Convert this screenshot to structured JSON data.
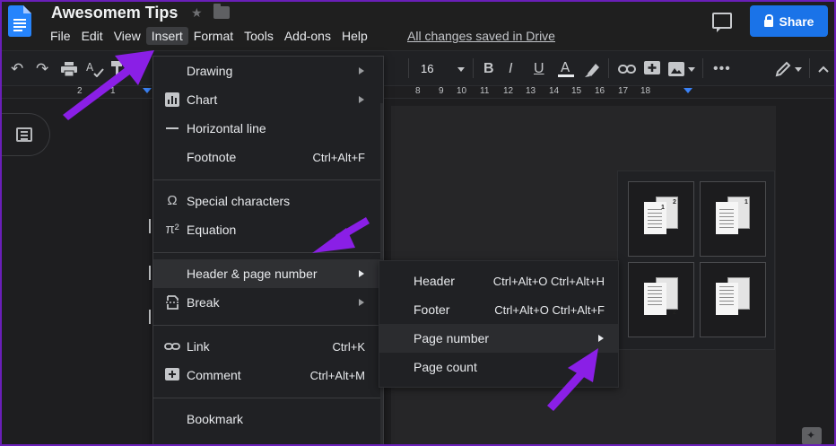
{
  "window": {
    "doc_title": "Awesomem Tips",
    "saved_status": "All changes saved in Drive",
    "share_label": "Share"
  },
  "menubar": [
    "File",
    "Edit",
    "View",
    "Insert",
    "Format",
    "Tools",
    "Add-ons",
    "Help"
  ],
  "toolbar": {
    "font_size": "16"
  },
  "ruler": {
    "labels": [
      "2",
      "1",
      "8",
      "9",
      "10",
      "11",
      "12",
      "13",
      "14",
      "15",
      "16",
      "17",
      "18"
    ]
  },
  "insert_menu": {
    "drawing": "Drawing",
    "chart": "Chart",
    "horizontal_line": "Horizontal line",
    "footnote": "Footnote",
    "footnote_shortcut": "Ctrl+Alt+F",
    "special_characters": "Special characters",
    "equation": "Equation",
    "header_page_number": "Header & page number",
    "break": "Break",
    "link": "Link",
    "link_shortcut": "Ctrl+K",
    "comment": "Comment",
    "comment_shortcut": "Ctrl+Alt+M",
    "bookmark": "Bookmark"
  },
  "submenu": {
    "header": "Header",
    "header_shortcut": "Ctrl+Alt+O Ctrl+Alt+H",
    "footer": "Footer",
    "footer_shortcut": "Ctrl+Alt+O Ctrl+Alt+F",
    "page_number": "Page number",
    "page_count": "Page count"
  },
  "page_number_options": {
    "top_right": "2",
    "top_right_skip_first": "1",
    "bottom_right": "2",
    "bottom_right_skip_first": "1"
  },
  "colors": {
    "accent": "#1a73e8",
    "annotation_arrow": "#8a1fe6",
    "background": "#1e1e20",
    "menu_bg": "#202124"
  },
  "icons": {
    "doc_logo": "google-docs-icon",
    "star": "star-icon",
    "folder": "folder-icon",
    "comment": "comment-history-icon",
    "lock": "lock-icon",
    "outline": "document-outline-icon"
  }
}
